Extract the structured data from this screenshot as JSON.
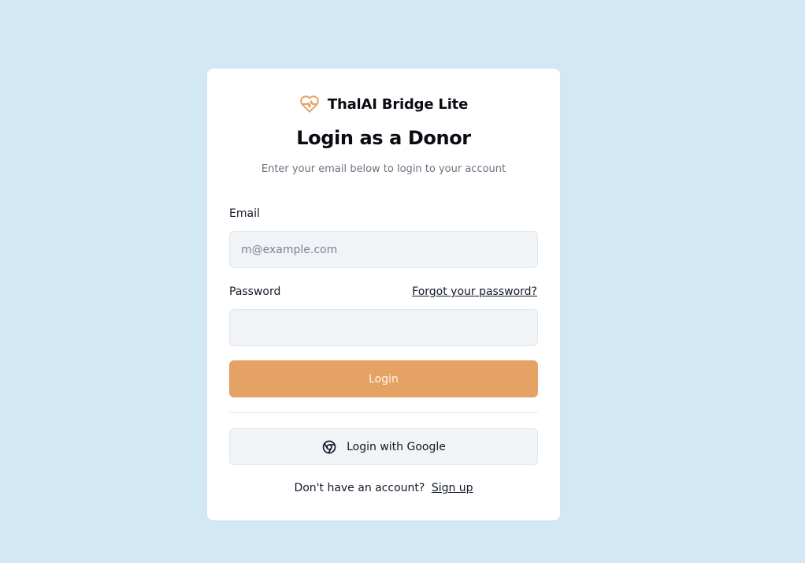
{
  "brand": {
    "name": "ThalAI Bridge Lite",
    "icon": "heart-pulse-icon",
    "icon_color": "#e6a265"
  },
  "form": {
    "title": "Login as a Donor",
    "subtitle": "Enter your email below to login to your account",
    "email": {
      "label": "Email",
      "placeholder": "m@example.com",
      "value": ""
    },
    "password": {
      "label": "Password",
      "value": "",
      "forgot_label": "Forgot your password?"
    },
    "login_label": "Login",
    "google": {
      "label": "Login with Google",
      "icon": "chrome-icon"
    },
    "signup": {
      "prompt": "Don't have an account?",
      "link_label": "Sign up"
    }
  },
  "colors": {
    "background": "#d2e8f4",
    "card": "#ffffff",
    "accent": "#e6a265",
    "input_bg": "#f0f4f7"
  }
}
